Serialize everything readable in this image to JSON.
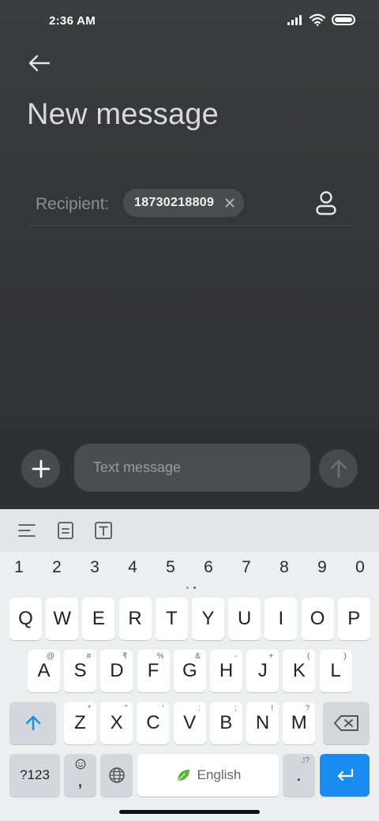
{
  "status_bar": {
    "time": "2:36 AM"
  },
  "header": {
    "title": "New message"
  },
  "recipient": {
    "label": "Recipient:",
    "chips": [
      {
        "number": "18730218809"
      }
    ]
  },
  "compose": {
    "placeholder": "Text message"
  },
  "keyboard": {
    "number_row": [
      "1",
      "2",
      "3",
      "4",
      "5",
      "6",
      "7",
      "8",
      "9",
      "0"
    ],
    "row1": [
      {
        "key": "Q"
      },
      {
        "key": "W"
      },
      {
        "key": "E"
      },
      {
        "key": "R"
      },
      {
        "key": "T"
      },
      {
        "key": "Y"
      },
      {
        "key": "U"
      },
      {
        "key": "I"
      },
      {
        "key": "O"
      },
      {
        "key": "P"
      }
    ],
    "row2": [
      {
        "key": "A",
        "hint": "@"
      },
      {
        "key": "S",
        "hint": "#"
      },
      {
        "key": "D",
        "hint": "₹"
      },
      {
        "key": "F",
        "hint": "%"
      },
      {
        "key": "G",
        "hint": "&"
      },
      {
        "key": "H",
        "hint": "-"
      },
      {
        "key": "J",
        "hint": "+"
      },
      {
        "key": "K",
        "hint": "("
      },
      {
        "key": "L",
        "hint": ")"
      }
    ],
    "row3": [
      {
        "key": "Z",
        "hint": "*"
      },
      {
        "key": "X",
        "hint": "\""
      },
      {
        "key": "C",
        "hint": "'"
      },
      {
        "key": "V",
        "hint": ":"
      },
      {
        "key": "B",
        "hint": ";"
      },
      {
        "key": "N",
        "hint": "!"
      },
      {
        "key": "M",
        "hint": "?"
      }
    ],
    "symbols_label": "?123",
    "comma": ",",
    "space_label": "English",
    "period": ".",
    "period_hint": ",!?"
  },
  "colors": {
    "accent": "#1a8cf0",
    "background": "#3a3b3e",
    "leaf": "#5cb33a"
  }
}
